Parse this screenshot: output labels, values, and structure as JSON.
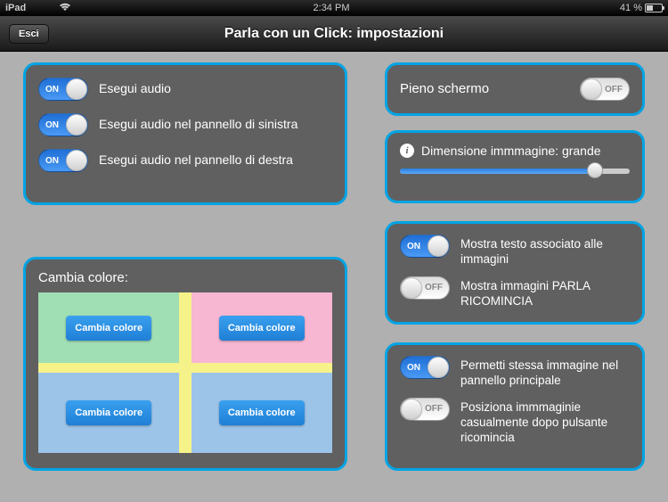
{
  "status": {
    "device": "iPad",
    "time": "2:34 PM",
    "battery_pct": "41 %"
  },
  "nav": {
    "exit": "Esci",
    "title": "Parla con un Click: impostazioni"
  },
  "audio": {
    "items": [
      {
        "on": true,
        "label": "Esegui audio"
      },
      {
        "on": true,
        "label": "Esegui audio nel pannello di sinistra"
      },
      {
        "on": true,
        "label": "Esegui audio nel pannello di destra"
      }
    ]
  },
  "fullscreen": {
    "label": "Pieno schermo",
    "on": false
  },
  "image_size": {
    "label": "Dimensione immmagine: grande",
    "value_pct": 85
  },
  "show": {
    "items": [
      {
        "on": true,
        "label": "Mostra testo associato alle immagini"
      },
      {
        "on": false,
        "label": "Mostra immagini PARLA RICOMINCIA"
      }
    ]
  },
  "position": {
    "items": [
      {
        "on": true,
        "label": "Permetti stessa immagine nel pannello principale"
      },
      {
        "on": false,
        "label": "Posiziona immmaginie casualmente dopo pulsante ricomincia"
      }
    ]
  },
  "color_panel": {
    "title": "Cambia colore:",
    "btn": "Cambia colore",
    "cells": {
      "top_left": "#a0deb4",
      "top_right": "#f7b6d2",
      "divider": "#f5f28a",
      "bottom": "#9cc3e8"
    }
  },
  "toggle_text": {
    "on": "ON",
    "off": "OFF"
  }
}
